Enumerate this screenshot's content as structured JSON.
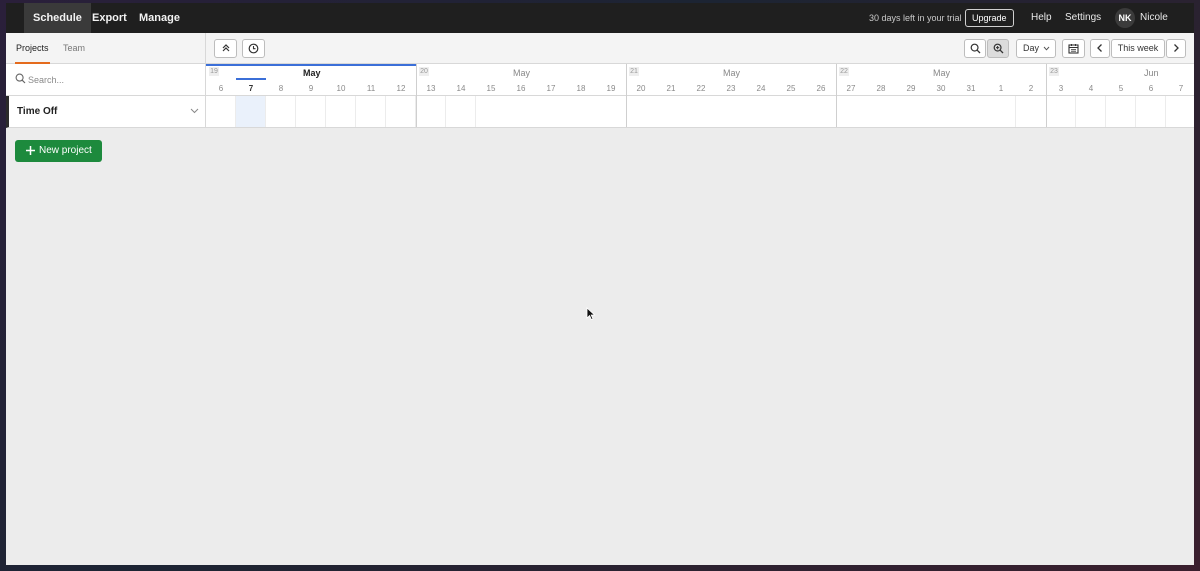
{
  "nav": {
    "items": [
      "Schedule",
      "Export",
      "Manage"
    ],
    "trial_text": "30 days left in your trial",
    "upgrade_label": "Upgrade",
    "help_label": "Help",
    "settings_label": "Settings",
    "user_initials": "NK",
    "user_name": "Nicole"
  },
  "left_tabs": [
    "Projects",
    "Team"
  ],
  "toolbar": {
    "view_select": "Day",
    "this_week_label": "This week",
    "icons": [
      "collapse-icon",
      "clock-icon",
      "zoom-out-icon",
      "zoom-in-icon",
      "calendar-icon",
      "chevron-left-icon",
      "chevron-right-icon"
    ]
  },
  "search": {
    "placeholder": "Search..."
  },
  "timeline": {
    "weeks": [
      {
        "number": "19",
        "month": "May",
        "days": [
          "6",
          "7",
          "8",
          "9",
          "10",
          "11",
          "12"
        ]
      },
      {
        "number": "20",
        "month": "May",
        "days": [
          "13",
          "14",
          "15",
          "16",
          "17",
          "18",
          "19"
        ]
      },
      {
        "number": "21",
        "month": "May",
        "days": [
          "20",
          "21",
          "22",
          "23",
          "24",
          "25",
          "26"
        ]
      },
      {
        "number": "22",
        "month": "May",
        "days": [
          "27",
          "28",
          "29",
          "30",
          "31",
          "1",
          "2"
        ]
      },
      {
        "number": "23",
        "month": "Jun",
        "days": [
          "3",
          "4",
          "5",
          "6",
          "7"
        ]
      }
    ],
    "today": "7"
  },
  "projects": [
    {
      "name": "Time Off"
    }
  ],
  "new_project_label": "New project",
  "colors": {
    "accent_tab": "#e46b1d",
    "primary_button": "#1d8a3d",
    "today_line": "#3b6fd8"
  }
}
